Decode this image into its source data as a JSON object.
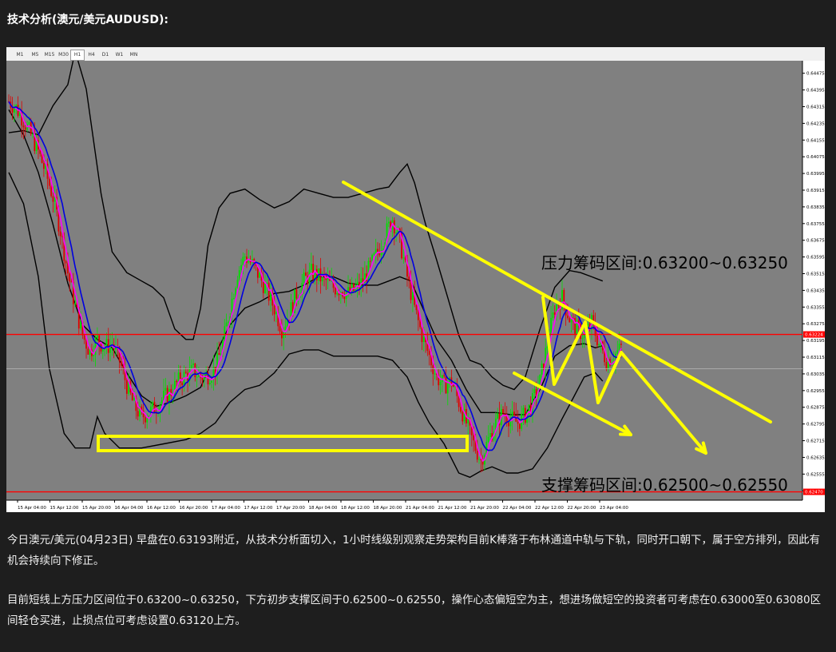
{
  "page": {
    "heading": "技术分析(澳元/美元AUDUSD):",
    "paragraphs": [
      "今日澳元/美元(04月23日) 早盘在0.63193附近，从技术分析面切入，1小时线级别观察走势架构目前K棒落于布林通道中轨与下轨，同时开口朝下，属于空方排列，因此有机会持续向下修正。",
      "目前短线上方压力区间位于0.63200~0.63250，下方初步支撑区间于0.62500~0.62550，操作心态偏短空为主，想进场做短空的投资者可考虑在0.63000至0.63080区间轻仓买进，止损点位可考虑设置0.63120上方。"
    ]
  },
  "toolbar": {
    "timeframes": [
      "M1",
      "M5",
      "M15",
      "M30",
      "H1",
      "H4",
      "D1",
      "W1",
      "MN"
    ],
    "active": "H1"
  },
  "colors": {
    "plot_bg": "#808080",
    "bull": "#00e000",
    "bear": "#e00000",
    "ma_blue": "#0000e0",
    "ma_magenta": "#ff00ff",
    "band": "#000000",
    "level": "#ff0000",
    "annotation": "#ffff00"
  },
  "chart_data": {
    "type": "candlestick",
    "symbol": "AUDUSD",
    "timeframe": "H1",
    "ylim": [
      0.6243,
      0.64535
    ],
    "y_ticks": [
      0.64475,
      0.64395,
      0.64315,
      0.64235,
      0.64155,
      0.64075,
      0.63995,
      0.63915,
      0.63835,
      0.63755,
      0.63675,
      0.63595,
      0.63515,
      0.63435,
      0.63355,
      0.63275,
      0.63195,
      0.63115,
      0.63035,
      0.62955,
      0.62875,
      0.62795,
      0.62715,
      0.62635,
      0.62555,
      0.62475
    ],
    "x_labels": [
      "15 Apr 04:00",
      "15 Apr 12:00",
      "15 Apr 20:00",
      "16 Apr 04:00",
      "16 Apr 12:00",
      "16 Apr 20:00",
      "17 Apr 04:00",
      "17 Apr 12:00",
      "17 Apr 20:00",
      "18 Apr 04:00",
      "18 Apr 12:00",
      "18 Apr 20:00",
      "21 Apr 04:00",
      "21 Apr 12:00",
      "21 Apr 20:00",
      "22 Apr 04:00",
      "22 Apr 12:00",
      "22 Apr 20:00",
      "23 Apr 04:00"
    ],
    "price_markers": [
      0.63224,
      0.63059,
      0.6247
    ],
    "resistance_label": "压力筹码区间:0.63200~0.63250",
    "support_label": "支撑筹码区间:0.62500~0.62550",
    "close_path": [
      [
        0,
        0.6434
      ],
      [
        4,
        0.6431
      ],
      [
        8,
        0.6425
      ],
      [
        12,
        0.6418
      ],
      [
        16,
        0.641
      ],
      [
        20,
        0.64
      ],
      [
        24,
        0.6388
      ],
      [
        28,
        0.6372
      ],
      [
        32,
        0.6352
      ],
      [
        36,
        0.6336
      ],
      [
        40,
        0.6322
      ],
      [
        44,
        0.6314
      ],
      [
        48,
        0.632
      ],
      [
        52,
        0.6316
      ],
      [
        56,
        0.6318
      ],
      [
        60,
        0.631
      ],
      [
        64,
        0.6298
      ],
      [
        68,
        0.6288
      ],
      [
        72,
        0.6283
      ],
      [
        76,
        0.6285
      ],
      [
        80,
        0.6288
      ],
      [
        84,
        0.6292
      ],
      [
        88,
        0.6295
      ],
      [
        92,
        0.63
      ],
      [
        96,
        0.6303
      ],
      [
        100,
        0.6305
      ],
      [
        104,
        0.6302
      ],
      [
        108,
        0.6303
      ],
      [
        112,
        0.6306
      ],
      [
        116,
        0.6318
      ],
      [
        120,
        0.6335
      ],
      [
        124,
        0.6352
      ],
      [
        128,
        0.636
      ],
      [
        132,
        0.6356
      ],
      [
        136,
        0.635
      ],
      [
        140,
        0.6343
      ],
      [
        144,
        0.6335
      ],
      [
        148,
        0.6325
      ],
      [
        152,
        0.6332
      ],
      [
        156,
        0.6342
      ],
      [
        160,
        0.6348
      ],
      [
        164,
        0.6352
      ],
      [
        168,
        0.635
      ],
      [
        172,
        0.6348
      ],
      [
        176,
        0.6345
      ],
      [
        180,
        0.6344
      ],
      [
        184,
        0.6342
      ],
      [
        188,
        0.6344
      ],
      [
        192,
        0.6348
      ],
      [
        196,
        0.6355
      ],
      [
        200,
        0.6362
      ],
      [
        204,
        0.637
      ],
      [
        208,
        0.6378
      ],
      [
        212,
        0.6367
      ],
      [
        216,
        0.635
      ],
      [
        220,
        0.6335
      ],
      [
        224,
        0.6322
      ],
      [
        228,
        0.6312
      ],
      [
        232,
        0.6302
      ],
      [
        236,
        0.6298
      ],
      [
        240,
        0.63
      ],
      [
        244,
        0.629
      ],
      [
        248,
        0.628
      ],
      [
        252,
        0.627
      ],
      [
        256,
        0.6262
      ],
      [
        260,
        0.6272
      ],
      [
        264,
        0.628
      ],
      [
        268,
        0.6285
      ],
      [
        272,
        0.6282
      ],
      [
        276,
        0.628
      ],
      [
        280,
        0.6284
      ],
      [
        284,
        0.629
      ],
      [
        288,
        0.63
      ],
      [
        292,
        0.6318
      ],
      [
        296,
        0.6335
      ],
      [
        300,
        0.634
      ],
      [
        304,
        0.633
      ],
      [
        308,
        0.6325
      ],
      [
        312,
        0.6322
      ],
      [
        316,
        0.6328
      ],
      [
        320,
        0.6318
      ],
      [
        324,
        0.631
      ],
      [
        328,
        0.6312
      ],
      [
        332,
        0.6316
      ]
    ],
    "bollinger_upper": [
      [
        0,
        0.6419
      ],
      [
        8,
        0.642
      ],
      [
        16,
        0.6418
      ],
      [
        24,
        0.6432
      ],
      [
        32,
        0.6442
      ],
      [
        36,
        0.6458
      ],
      [
        42,
        0.644
      ],
      [
        50,
        0.639
      ],
      [
        56,
        0.6362
      ],
      [
        64,
        0.6352
      ],
      [
        72,
        0.6348
      ],
      [
        78,
        0.6345
      ],
      [
        84,
        0.634
      ],
      [
        90,
        0.6325
      ],
      [
        96,
        0.632
      ],
      [
        100,
        0.632
      ],
      [
        104,
        0.6335
      ],
      [
        108,
        0.6365
      ],
      [
        114,
        0.6383
      ],
      [
        120,
        0.639
      ],
      [
        128,
        0.6392
      ],
      [
        136,
        0.6387
      ],
      [
        144,
        0.6383
      ],
      [
        152,
        0.6386
      ],
      [
        160,
        0.6392
      ],
      [
        168,
        0.639
      ],
      [
        176,
        0.6388
      ],
      [
        184,
        0.6388
      ],
      [
        192,
        0.639
      ],
      [
        200,
        0.6392
      ],
      [
        206,
        0.6393
      ],
      [
        212,
        0.64
      ],
      [
        216,
        0.6404
      ],
      [
        220,
        0.6395
      ],
      [
        226,
        0.6375
      ],
      [
        232,
        0.6358
      ],
      [
        238,
        0.634
      ],
      [
        244,
        0.6322
      ],
      [
        250,
        0.631
      ],
      [
        256,
        0.6308
      ],
      [
        262,
        0.6302
      ],
      [
        268,
        0.6298
      ],
      [
        274,
        0.6296
      ],
      [
        280,
        0.6302
      ],
      [
        288,
        0.6325
      ],
      [
        296,
        0.6345
      ],
      [
        304,
        0.6353
      ],
      [
        310,
        0.6352
      ],
      [
        316,
        0.635
      ],
      [
        322,
        0.6348
      ]
    ],
    "bollinger_middle": [
      [
        0,
        0.643
      ],
      [
        8,
        0.6418
      ],
      [
        16,
        0.64
      ],
      [
        24,
        0.6375
      ],
      [
        32,
        0.6347
      ],
      [
        40,
        0.6327
      ],
      [
        48,
        0.632
      ],
      [
        56,
        0.6316
      ],
      [
        64,
        0.6304
      ],
      [
        72,
        0.6293
      ],
      [
        80,
        0.6288
      ],
      [
        88,
        0.629
      ],
      [
        96,
        0.6293
      ],
      [
        104,
        0.6297
      ],
      [
        112,
        0.6313
      ],
      [
        120,
        0.6327
      ],
      [
        128,
        0.6335
      ],
      [
        136,
        0.6338
      ],
      [
        144,
        0.6342
      ],
      [
        152,
        0.6343
      ],
      [
        160,
        0.6346
      ],
      [
        168,
        0.635
      ],
      [
        176,
        0.635
      ],
      [
        184,
        0.6347
      ],
      [
        192,
        0.6346
      ],
      [
        200,
        0.6346
      ],
      [
        206,
        0.6348
      ],
      [
        212,
        0.635
      ],
      [
        218,
        0.6348
      ],
      [
        224,
        0.6336
      ],
      [
        232,
        0.632
      ],
      [
        240,
        0.631
      ],
      [
        248,
        0.6296
      ],
      [
        256,
        0.6285
      ],
      [
        264,
        0.6285
      ],
      [
        272,
        0.6284
      ],
      [
        280,
        0.6284
      ],
      [
        288,
        0.6296
      ],
      [
        296,
        0.6312
      ],
      [
        304,
        0.6317
      ],
      [
        312,
        0.6318
      ],
      [
        318,
        0.6316
      ],
      [
        322,
        0.6317
      ]
    ],
    "bollinger_lower": [
      [
        0,
        0.64
      ],
      [
        8,
        0.6385
      ],
      [
        16,
        0.635
      ],
      [
        22,
        0.6306
      ],
      [
        30,
        0.6275
      ],
      [
        36,
        0.6268
      ],
      [
        44,
        0.6268
      ],
      [
        48,
        0.6283
      ],
      [
        52,
        0.6275
      ],
      [
        60,
        0.6268
      ],
      [
        66,
        0.6268
      ],
      [
        72,
        0.6268
      ],
      [
        84,
        0.627
      ],
      [
        96,
        0.6272
      ],
      [
        104,
        0.6275
      ],
      [
        112,
        0.628
      ],
      [
        120,
        0.629
      ],
      [
        128,
        0.6296
      ],
      [
        136,
        0.6298
      ],
      [
        144,
        0.6304
      ],
      [
        152,
        0.6313
      ],
      [
        160,
        0.6315
      ],
      [
        168,
        0.6315
      ],
      [
        176,
        0.6312
      ],
      [
        184,
        0.6312
      ],
      [
        192,
        0.6312
      ],
      [
        200,
        0.6312
      ],
      [
        208,
        0.631
      ],
      [
        216,
        0.6302
      ],
      [
        222,
        0.629
      ],
      [
        228,
        0.628
      ],
      [
        236,
        0.627
      ],
      [
        244,
        0.6256
      ],
      [
        250,
        0.6254
      ],
      [
        256,
        0.6257
      ],
      [
        262,
        0.6259
      ],
      [
        270,
        0.6256
      ],
      [
        276,
        0.6256
      ],
      [
        284,
        0.6258
      ],
      [
        292,
        0.6268
      ],
      [
        300,
        0.6282
      ],
      [
        306,
        0.6292
      ],
      [
        312,
        0.6302
      ],
      [
        318,
        0.6304
      ],
      [
        322,
        0.63
      ]
    ]
  },
  "icons": [
    "arrow-down-right-icon"
  ]
}
